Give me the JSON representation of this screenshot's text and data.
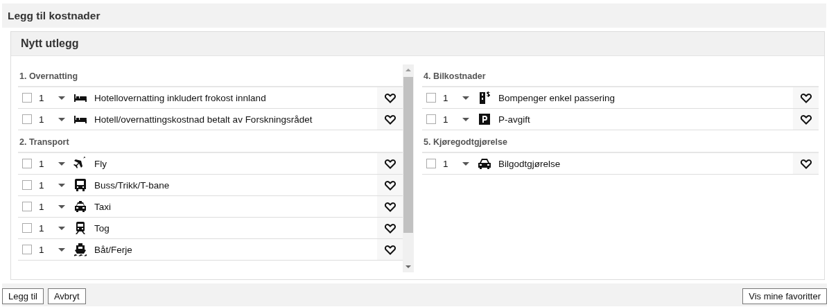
{
  "page_title": "Legg til kostnader",
  "panel": {
    "title": "Nytt utlegg",
    "left_column": {
      "sections": [
        {
          "title": "1. Overnatting",
          "items": [
            {
              "kind": "bed",
              "checked": false,
              "quantity": "1",
              "label": "Hotellovernatting inkludert frokost innland"
            },
            {
              "kind": "bed",
              "checked": false,
              "quantity": "1",
              "label": "Hotell/overnattingskostnad betalt av Forskningsrådet"
            }
          ]
        },
        {
          "title": "2. Transport",
          "items": [
            {
              "kind": "plane",
              "checked": false,
              "quantity": "1",
              "label": "Fly"
            },
            {
              "kind": "bus",
              "checked": false,
              "quantity": "1",
              "label": "Buss/Trikk/T-bane"
            },
            {
              "kind": "taxi",
              "checked": false,
              "quantity": "1",
              "label": "Taxi"
            },
            {
              "kind": "train",
              "checked": false,
              "quantity": "1",
              "label": "Tog"
            },
            {
              "kind": "boat",
              "checked": false,
              "quantity": "1",
              "label": "Båt/Ferje"
            }
          ]
        }
      ]
    },
    "right_column": {
      "sections": [
        {
          "title": "4. Bilkostnader",
          "items": [
            {
              "kind": "toll",
              "checked": false,
              "quantity": "1",
              "label": "Bompenger enkel passering"
            },
            {
              "kind": "parking",
              "checked": false,
              "quantity": "1",
              "label": "P-avgift"
            }
          ]
        },
        {
          "title": "5. Kjøregodtgjørelse",
          "items": [
            {
              "kind": "car",
              "checked": false,
              "quantity": "1",
              "label": "Bilgodtgjørelse"
            }
          ]
        }
      ]
    }
  },
  "footer": {
    "buttons": [
      "Legg til",
      "Avbryt"
    ],
    "favorites_button": "Vis mine favoritter"
  }
}
